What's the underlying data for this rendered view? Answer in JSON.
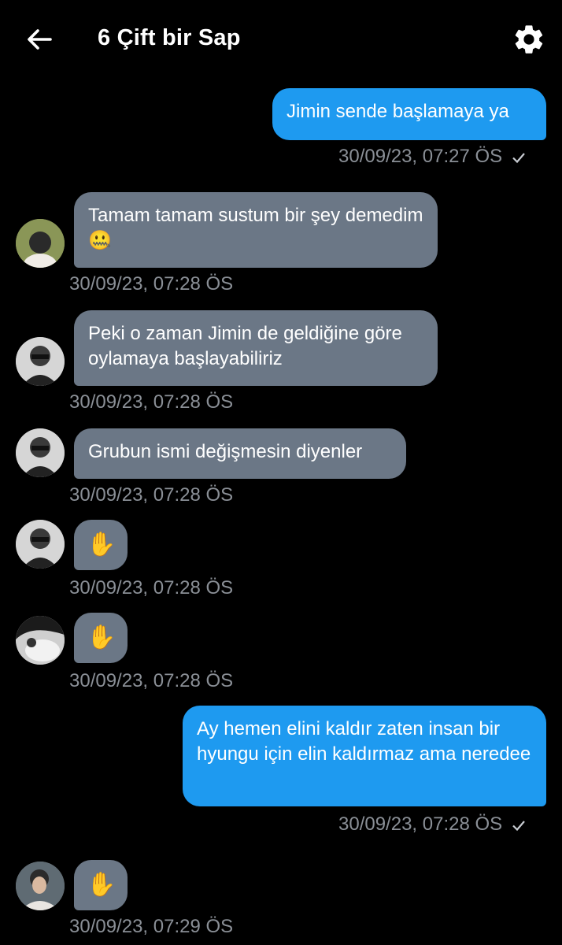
{
  "header": {
    "title": "6 Çift bir Sap"
  },
  "messages": [
    {
      "dir": "out",
      "text": "Jimin sende başlamaya ya",
      "time": "30/09/23, 07:27 ÖS"
    },
    {
      "dir": "in",
      "text": "Tamam tamam sustum bir şey demedim🤐",
      "time": "30/09/23, 07:28 ÖS"
    },
    {
      "dir": "in",
      "text": "Peki o zaman Jimin de geldiğine göre oylamaya başlayabiliriz",
      "time": "30/09/23, 07:28 ÖS"
    },
    {
      "dir": "in",
      "text": "Grubun ismi değişmesin diyenler",
      "time": "30/09/23, 07:28 ÖS"
    },
    {
      "dir": "in",
      "text": "✋",
      "time": "30/09/23, 07:28 ÖS"
    },
    {
      "dir": "in",
      "text": "✋",
      "time": "30/09/23, 07:28 ÖS"
    },
    {
      "dir": "out",
      "text": "Ay hemen elini kaldır zaten insan bir hyungu için elin kaldırmaz ama neredee",
      "time": "30/09/23, 07:28 ÖS"
    },
    {
      "dir": "in",
      "text": "✋",
      "time": "30/09/23, 07:29 ÖS"
    }
  ],
  "colors": {
    "outgoing": "#1e9af0",
    "incoming": "#6b7786",
    "timestamp": "#8a8f96"
  },
  "icons": {
    "back": "arrow-left-icon",
    "settings": "gear-icon",
    "sent": "check-icon"
  }
}
